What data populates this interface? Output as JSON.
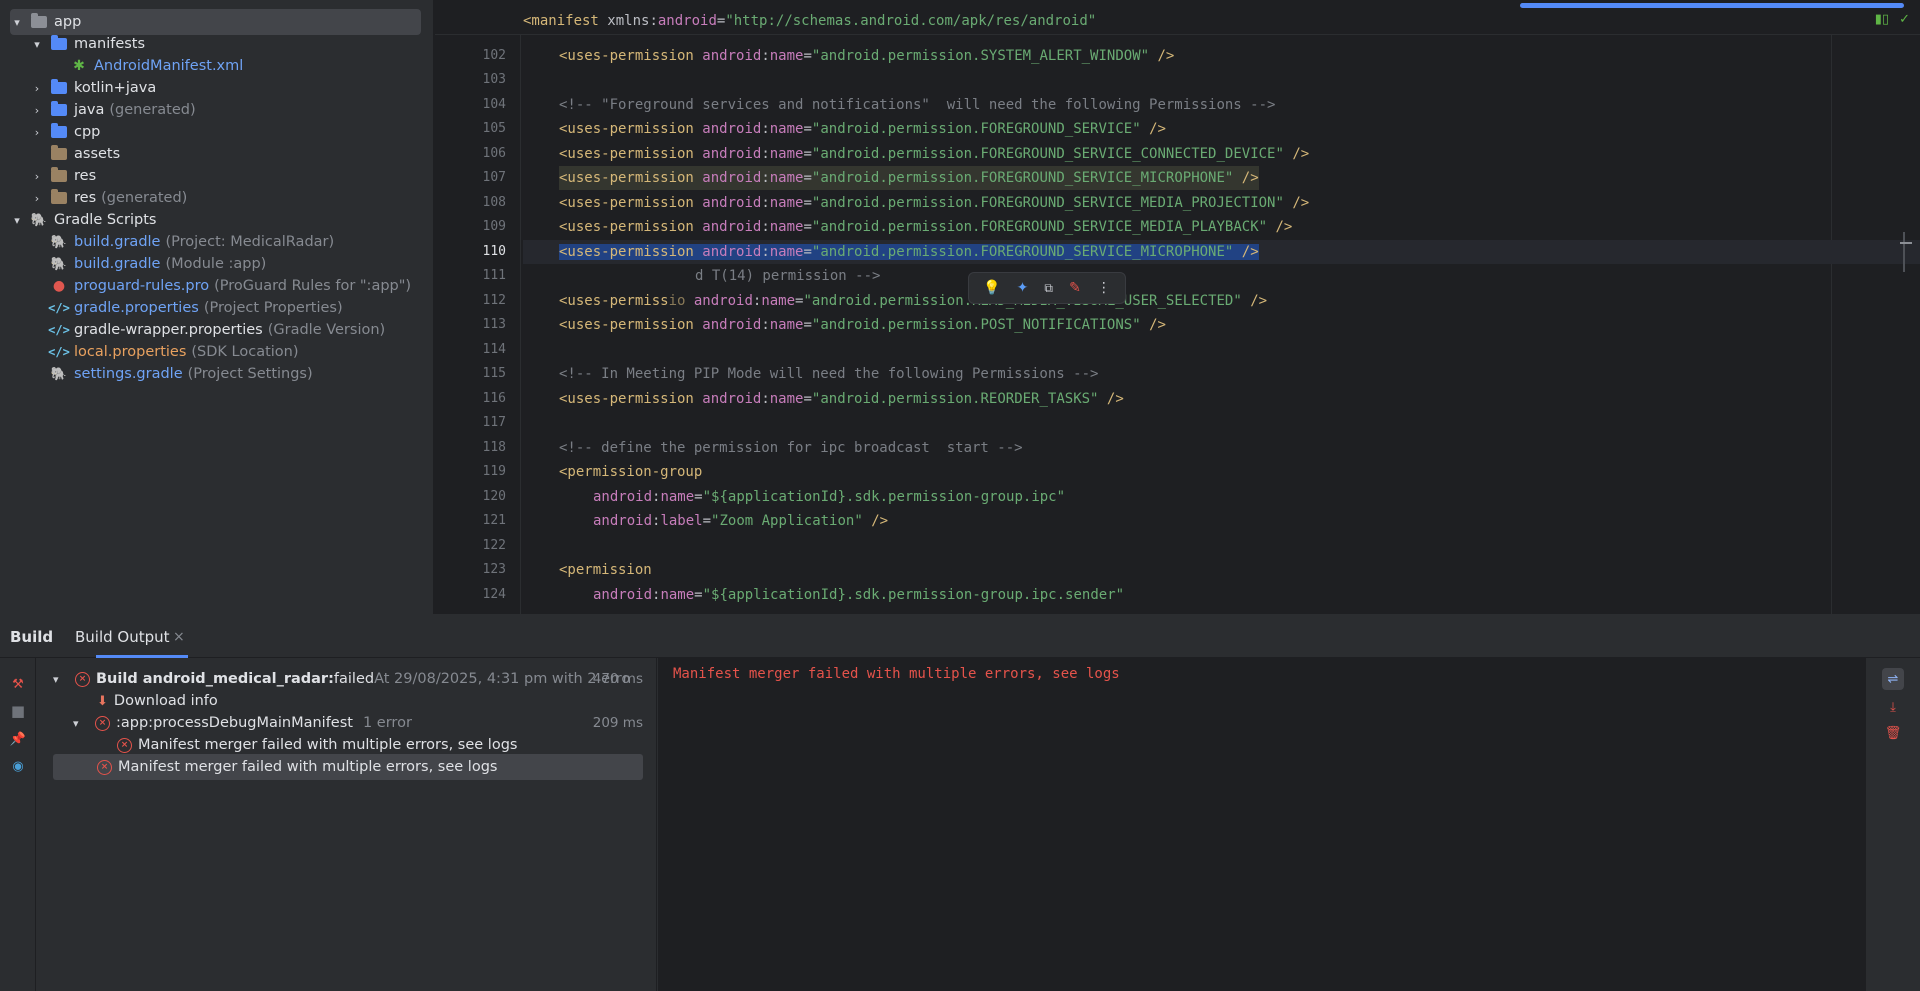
{
  "project_tree": {
    "items": [
      {
        "label": "app",
        "extra": ""
      },
      {
        "label": "manifests",
        "extra": ""
      },
      {
        "label": "AndroidManifest.xml",
        "extra": ""
      },
      {
        "label": "kotlin+java",
        "extra": ""
      },
      {
        "label": "java",
        "extra": "(generated)"
      },
      {
        "label": "cpp",
        "extra": ""
      },
      {
        "label": "assets",
        "extra": ""
      },
      {
        "label": "res",
        "extra": ""
      },
      {
        "label": "res",
        "extra": "(generated)"
      },
      {
        "label": "Gradle Scripts",
        "extra": ""
      },
      {
        "label": "build.gradle",
        "extra": "(Project: MedicalRadar)"
      },
      {
        "label": "build.gradle",
        "extra": "(Module :app)"
      },
      {
        "label": "proguard-rules.pro",
        "extra": "(ProGuard Rules for \":app\")"
      },
      {
        "label": "gradle.properties",
        "extra": "(Project Properties)"
      },
      {
        "label": "gradle-wrapper.properties",
        "extra": "(Gradle Version)"
      },
      {
        "label": "local.properties",
        "extra": "(SDK Location)"
      },
      {
        "label": "settings.gradle",
        "extra": "(Project Settings)"
      }
    ]
  },
  "editor": {
    "sticky_line_number": "2",
    "sticky_line": {
      "tag": "<manifest ",
      "attr_pre": "xmlns:",
      "attr": "android",
      "eq": "=",
      "value": "\"http://schemas.android.com/apk/res/android\""
    },
    "line_numbers": [
      "102",
      "103",
      "104",
      "105",
      "106",
      "107",
      "108",
      "109",
      "110",
      "111",
      "112",
      "113",
      "114",
      "115",
      "116",
      "117",
      "118",
      "119",
      "120",
      "121",
      "122",
      "123",
      "124"
    ],
    "current_line": "110",
    "lines": {
      "l102": "\"android.permission.SYSTEM_ALERT_WINDOW\"",
      "l104": "<!-- \"Foreground services and notifications\"  will need the following Permissions -->",
      "l105": "\"android.permission.FOREGROUND_SERVICE\"",
      "l106": "\"android.permission.FOREGROUND_SERVICE_CONNECTED_DEVICE\"",
      "l107": "\"android.permission.FOREGROUND_SERVICE_MICROPHONE\"",
      "l108": "\"android.permission.FOREGROUND_SERVICE_MEDIA_PROJECTION\"",
      "l109": "\"android.permission.FOREGROUND_SERVICE_MEDIA_PLAYBACK\"",
      "l110": "\"android.permission.FOREGROUND_SERVICE_MICROPHONE\"",
      "l111": "d T(14) permission -->",
      "l112_pre": "<uses-permiss",
      "l112": "\"android.permission.READ_MEDIA_VISUAL_USER_SELECTED\"",
      "l113": "\"android.permission.POST_NOTIFICATIONS\"",
      "l115": "<!-- In Meeting PIP Mode will need the following Permissions -->",
      "l116": "\"android.permission.REORDER_TASKS\"",
      "l118": "<!-- define the permission for ipc broadcast  start -->",
      "l119": "<permission-group",
      "l120": "\"${applicationId}.sdk.permission-group.ipc\"",
      "l121": "\"Zoom Application\"",
      "l123": "<permission",
      "l124": "\"${applicationId}.sdk.permission-group.ipc.sender\""
    },
    "tokens": {
      "uses_permission": "<uses-permission ",
      "android": "android",
      "colon": ":",
      "name": "name",
      "label": "label",
      "eq": "=",
      "close": " />"
    }
  },
  "build_panel": {
    "tab_build": "Build",
    "tab_output": "Build Output",
    "tab_close": "×",
    "rows": {
      "root_label": "Build android_medical_radar:",
      "root_status": " failed",
      "root_time": " At 29/08/2025, 4:31 pm with 2 erro",
      "root_duration": "470 ms",
      "download": "Download info",
      "task": ":app:processDebugMainManifest",
      "task_errors": "1 error",
      "task_duration": "209 ms",
      "child_error": "Manifest merger failed with multiple errors, see logs",
      "top_error": "Manifest merger failed with multiple errors, see logs"
    },
    "output_text": "Manifest merger failed with multiple errors, see logs"
  },
  "colors": {
    "accent": "#548af7",
    "error": "#e5534b",
    "xml_tag": "#d5b778",
    "xml_attr": "#c77dbb",
    "xml_string": "#6aab73",
    "comment": "#7a7e85"
  }
}
